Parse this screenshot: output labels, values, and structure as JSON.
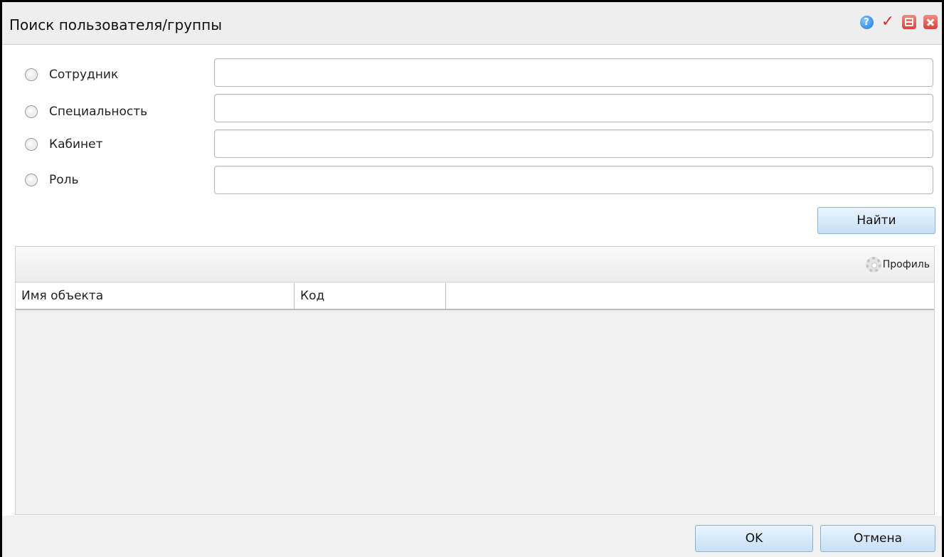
{
  "window": {
    "title": "Поиск пользователя/группы",
    "icons": [
      "help-icon",
      "apply-check-icon",
      "minimize-icon",
      "close-icon"
    ],
    "help_glyph": "?",
    "check_glyph": "✓"
  },
  "search": {
    "options": [
      {
        "label": "Сотрудник",
        "value": ""
      },
      {
        "label": "Специальность",
        "value": ""
      },
      {
        "label": "Кабинет",
        "value": ""
      },
      {
        "label": "Роль",
        "value": ""
      }
    ],
    "find_button": "Найти"
  },
  "grid": {
    "toolbar": {
      "profile_label": "Профиль",
      "profile_icon": "gear-icon"
    },
    "columns": [
      "Имя объекта",
      "Код",
      ""
    ],
    "rows": []
  },
  "footer": {
    "ok_button": "OK",
    "cancel_button": "Отмена"
  },
  "colors": {
    "button_border": "#8fb2d8",
    "button_bg_top": "#eaf4ff",
    "button_bg_bottom": "#c7dff7",
    "close_red": "#d6453a",
    "help_blue": "#1e78d4"
  }
}
